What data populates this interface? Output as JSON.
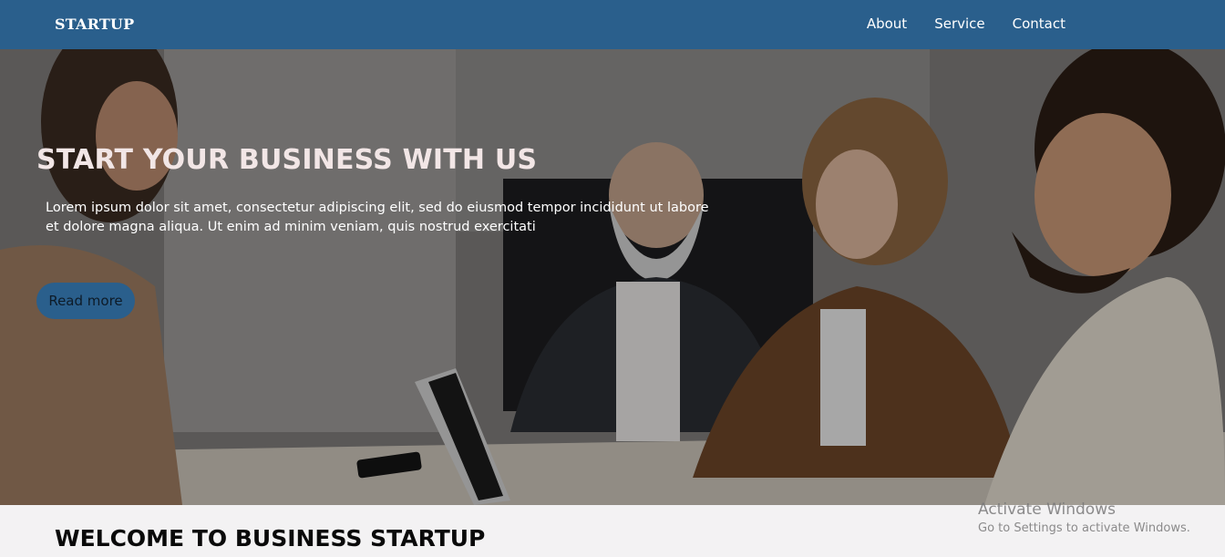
{
  "navbar": {
    "brand": "STARTUP",
    "links": [
      "About",
      "Service",
      "Contact"
    ]
  },
  "hero": {
    "title": "START YOUR BUSINESS WITH US",
    "text": "Lorem ipsum dolor sit amet, consectetur adipiscing elit, sed do eiusmod tempor incididunt ut labore et dolore magna aliqua. Ut enim ad minim veniam, quis nostrud exercitati",
    "button_label": "Read more"
  },
  "welcome": {
    "title": "WELCOME TO BUSINESS STARTUP"
  },
  "watermark": {
    "title": "Activate Windows",
    "subtitle": "Go to Settings to activate Windows."
  },
  "colors": {
    "navbar": "#2a5f8c",
    "button": "#2a5f8c",
    "page_bg": "#f3f2f3"
  }
}
